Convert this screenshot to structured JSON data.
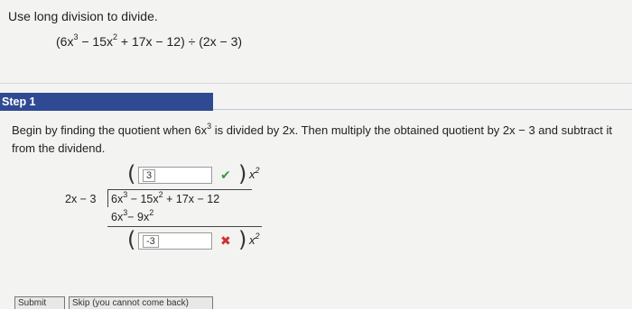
{
  "prompt": "Use long division to divide.",
  "problem": {
    "dividend_lead": "(6x",
    "e1": "3",
    "t2": " − 15x",
    "e2": "2",
    "rest": " + 17x − 12) ÷ (2x − 3)"
  },
  "step": {
    "label": "Step 1",
    "instr_a": "Begin by finding the quotient when 6x",
    "instr_e": "3",
    "instr_b": " is divided by 2x. Then multiply the obtained quotient by 2x − 3 and subtract it from the dividend."
  },
  "division": {
    "divisor": "2x − 3",
    "dividend": {
      "a": "6x",
      "ae": "3",
      "b": "− 15x",
      "be": "2",
      "c": " + 17x − 12"
    },
    "product": {
      "a": "6x",
      "ae": "3",
      "b": "− 9x",
      "be": "2"
    },
    "quotient_answer": "3",
    "quotient_status": "correct",
    "quotient_var": "x",
    "quotient_exp": "2",
    "remainder_answer": "-3",
    "remainder_status": "incorrect",
    "remainder_var": "x",
    "remainder_exp": "2",
    "check_icon": "✔",
    "cross_icon": "✖"
  },
  "buttons": {
    "submit": "Submit",
    "skip": "Skip (you cannot come back)"
  },
  "colors": {
    "banner": "#2f4a92",
    "correct": "#3a9a3a",
    "incorrect": "#d03030"
  }
}
